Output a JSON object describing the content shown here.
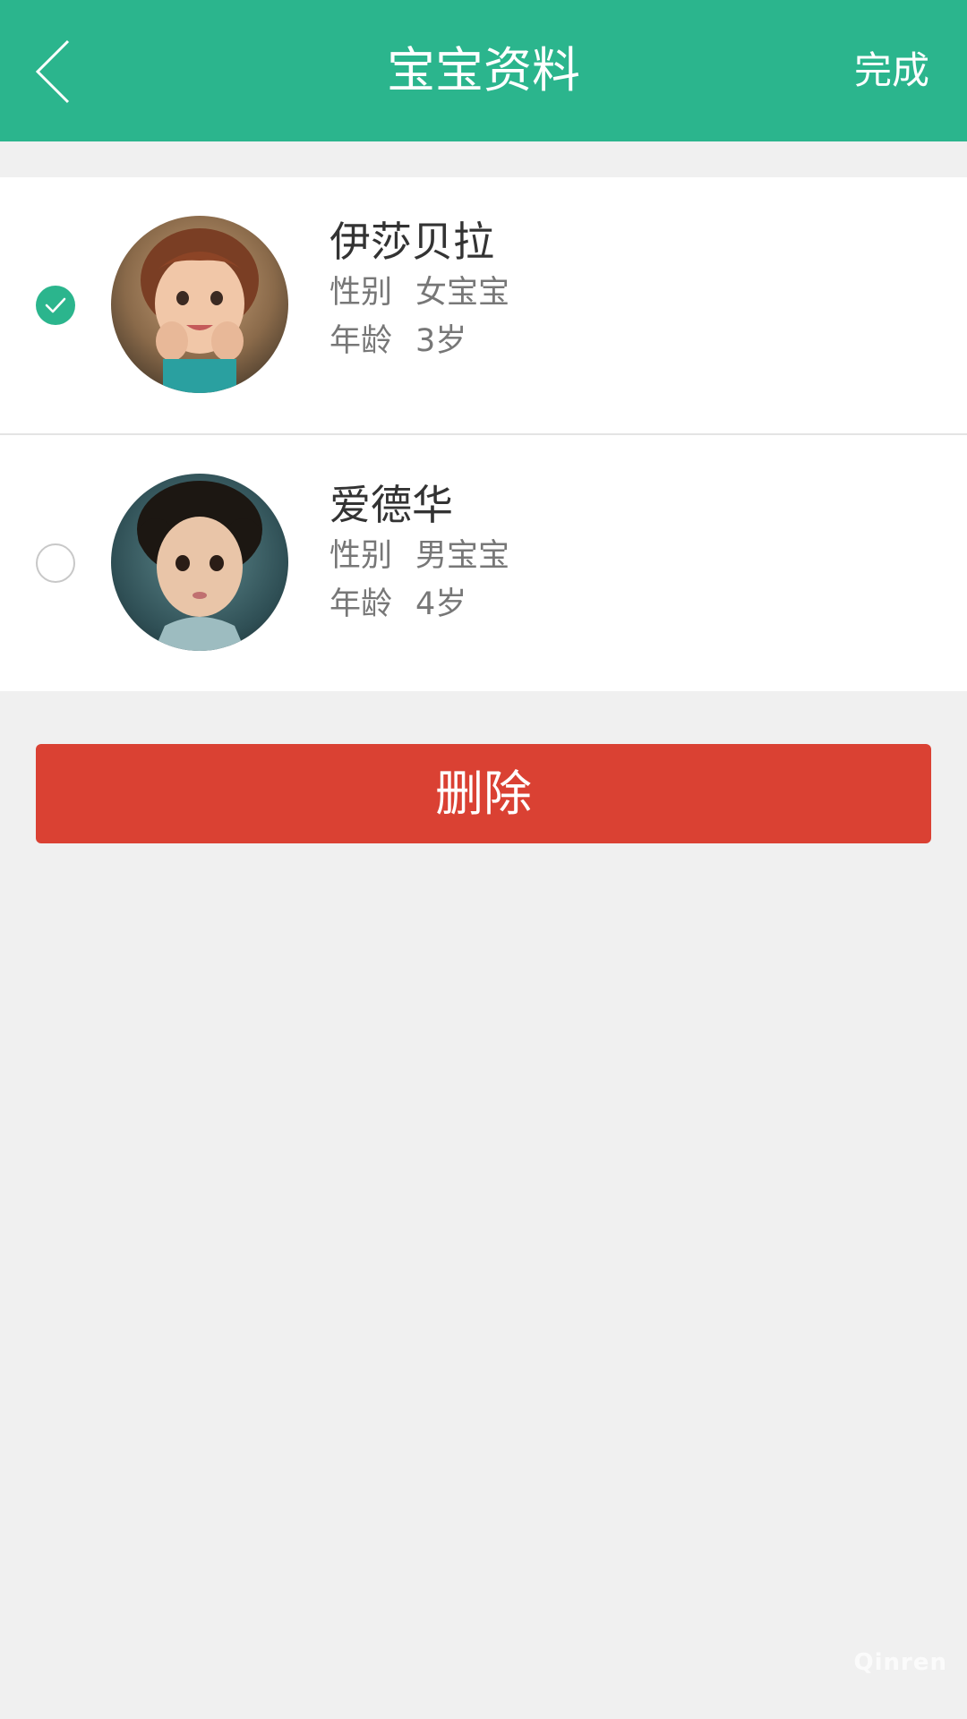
{
  "header": {
    "title": "宝宝资料",
    "done_label": "完成",
    "back_icon": "chevron-left-icon"
  },
  "colors": {
    "primary": "#2bb58d",
    "danger": "#da4133",
    "background": "#f0f0f0"
  },
  "babies": [
    {
      "name": "伊莎贝拉",
      "gender_label": "性别",
      "gender_value": "女宝宝",
      "age_label": "年龄",
      "age_value": "3岁",
      "selected": true
    },
    {
      "name": "爱德华",
      "gender_label": "性别",
      "gender_value": "男宝宝",
      "age_label": "年龄",
      "age_value": "4岁",
      "selected": false
    }
  ],
  "actions": {
    "delete_label": "删除"
  },
  "watermark": {
    "text": "Qinren"
  }
}
